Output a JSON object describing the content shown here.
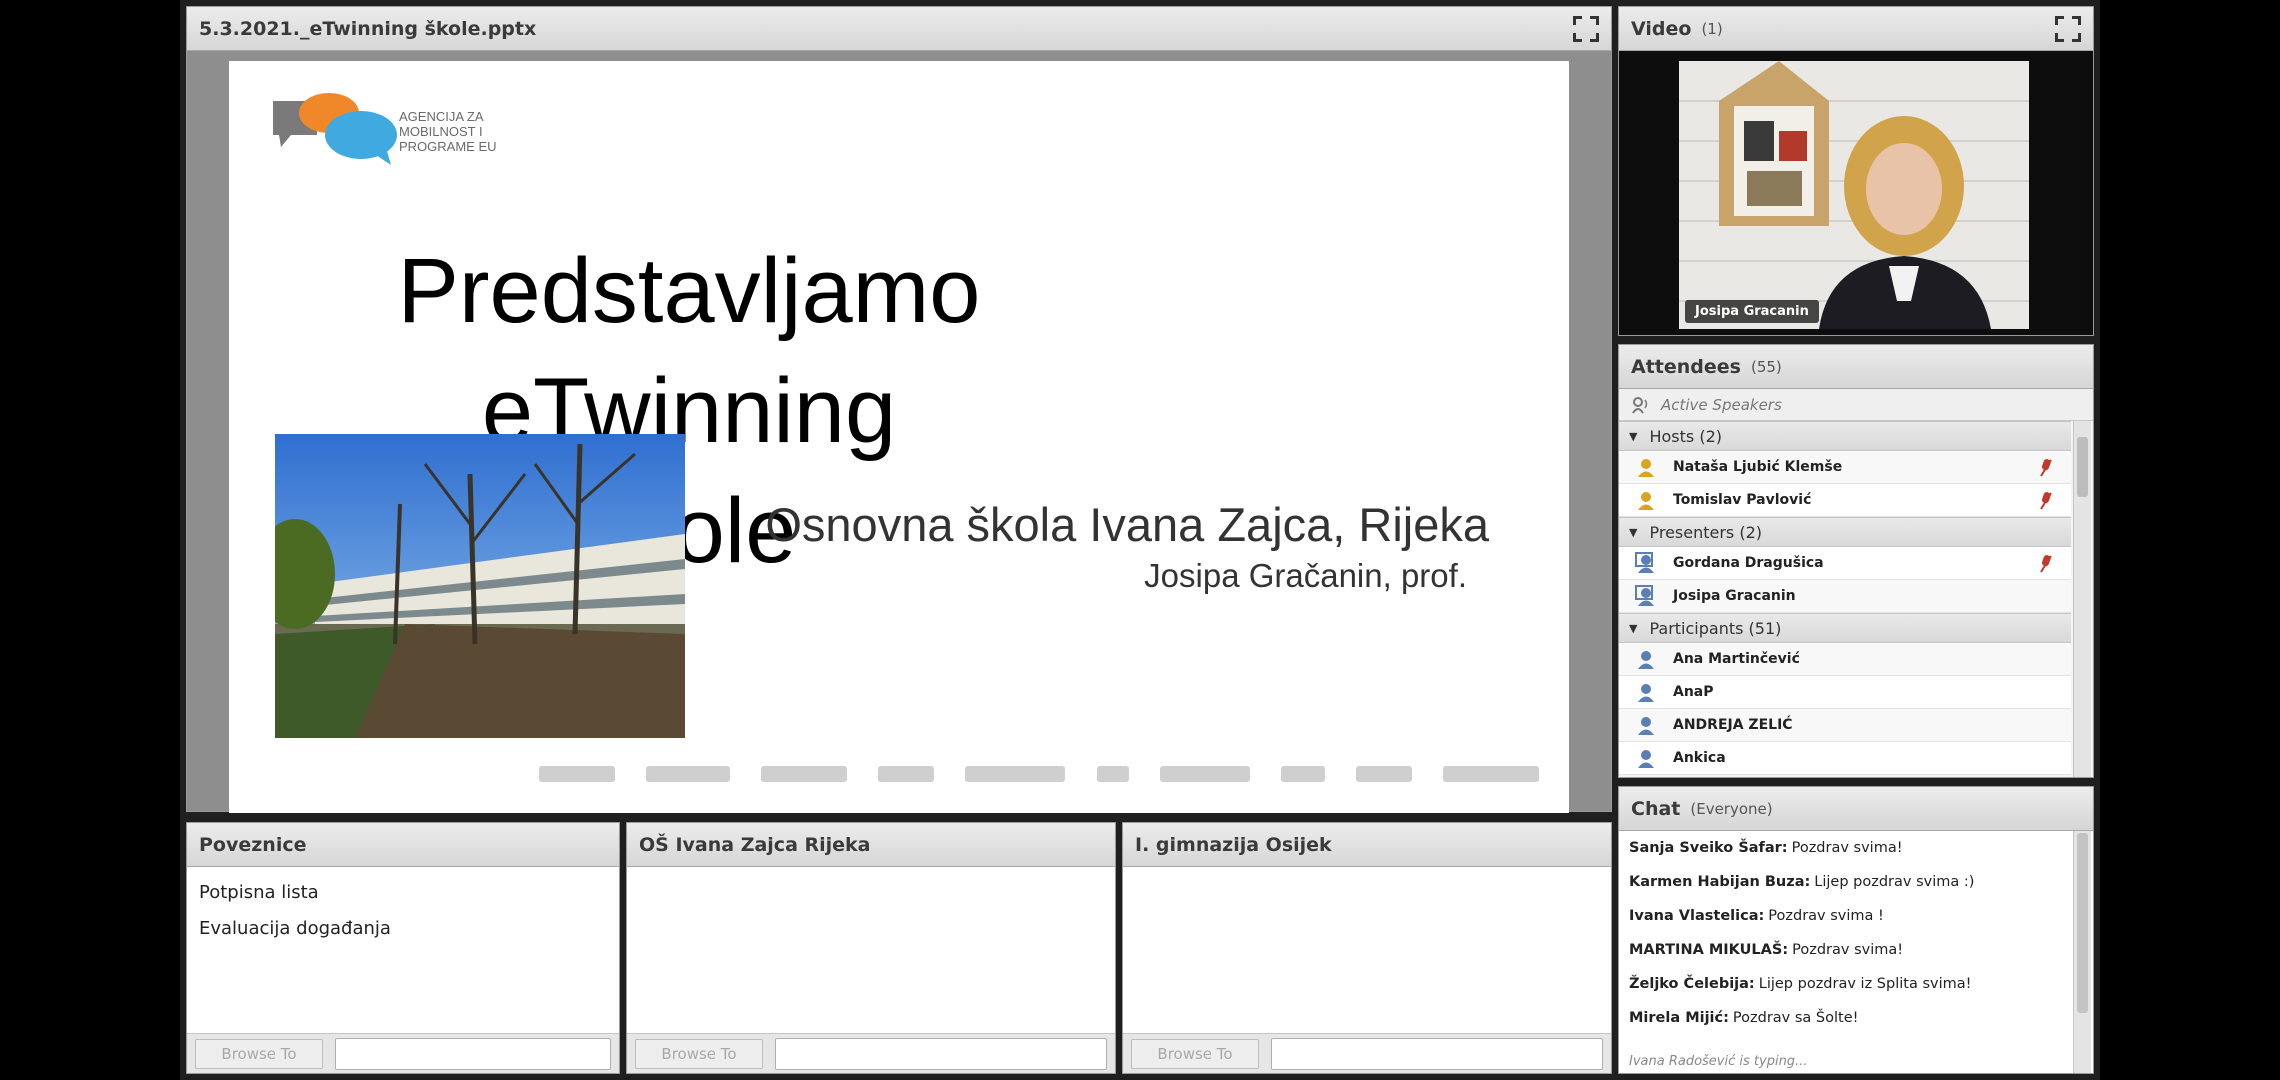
{
  "share": {
    "title": "5.3.2021._eTwinning škole.pptx",
    "slide": {
      "logo_text": "AGENCIJA ZA\nMOBILNOST I\nPROGRAME EU",
      "title_line1": "Predstavljamo eTwinning",
      "title_line2": "škole",
      "subtitle": "Osnovna škola Ivana Zajca, Rijeka",
      "author": "Josipa Gračanin, prof."
    }
  },
  "video": {
    "title": "Video",
    "count": "(1)",
    "camera_name": "Josipa Gracanin"
  },
  "attendees": {
    "title": "Attendees",
    "count": "(55)",
    "active_speakers": "Active Speakers",
    "groups": [
      {
        "label": "Hosts (2)",
        "people": [
          {
            "name": "Nataša Ljubić Klemše",
            "mic": true
          },
          {
            "name": "Tomislav  Pavlović",
            "mic": true
          }
        ]
      },
      {
        "label": "Presenters (2)",
        "people": [
          {
            "name": "Gordana Dragušica",
            "mic": true
          },
          {
            "name": "Josipa Gracanin",
            "mic": false
          }
        ]
      },
      {
        "label": "Participants (51)",
        "people": [
          {
            "name": "Ana Martinčević",
            "mic": false
          },
          {
            "name": "AnaP",
            "mic": false
          },
          {
            "name": "ANDREJA ZELIĆ",
            "mic": false
          },
          {
            "name": "Ankica",
            "mic": false
          }
        ]
      }
    ]
  },
  "chat": {
    "title": "Chat",
    "scope": "(Everyone)",
    "messages": [
      {
        "author": "Sanja Sveiko Šafar:",
        "text": "Pozdrav svima!"
      },
      {
        "author": "Karmen Habijan Buza:",
        "text": "Lijep pozdrav svima :)"
      },
      {
        "author": "Ivana Vlastelica:",
        "text": "Pozdrav svima !"
      },
      {
        "author": "MARTINA MIKULAŠ:",
        "text": "Pozdrav svima!"
      },
      {
        "author": "Željko Čelebija:",
        "text": "Lijep pozdrav iz Splita svima!"
      },
      {
        "author": "Mirela Mijić:",
        "text": "Pozdrav sa Šolte!"
      }
    ],
    "typing": "Ivana Radošević is typing..."
  },
  "links": [
    {
      "title": "Poveznice",
      "items": [
        "Potpisna lista",
        "Evaluacija događanja"
      ],
      "browse": "Browse To"
    },
    {
      "title": "OŠ Ivana Zajca Rijeka",
      "items": [],
      "browse": "Browse To"
    },
    {
      "title": "I. gimnazija Osijek",
      "items": [],
      "browse": "Browse To"
    }
  ],
  "colors": {
    "mic": "#c0392b",
    "host_icon": "#d9a520",
    "presenter_icon": "#5a7fb5",
    "participant_icon": "#5a7fb5"
  }
}
